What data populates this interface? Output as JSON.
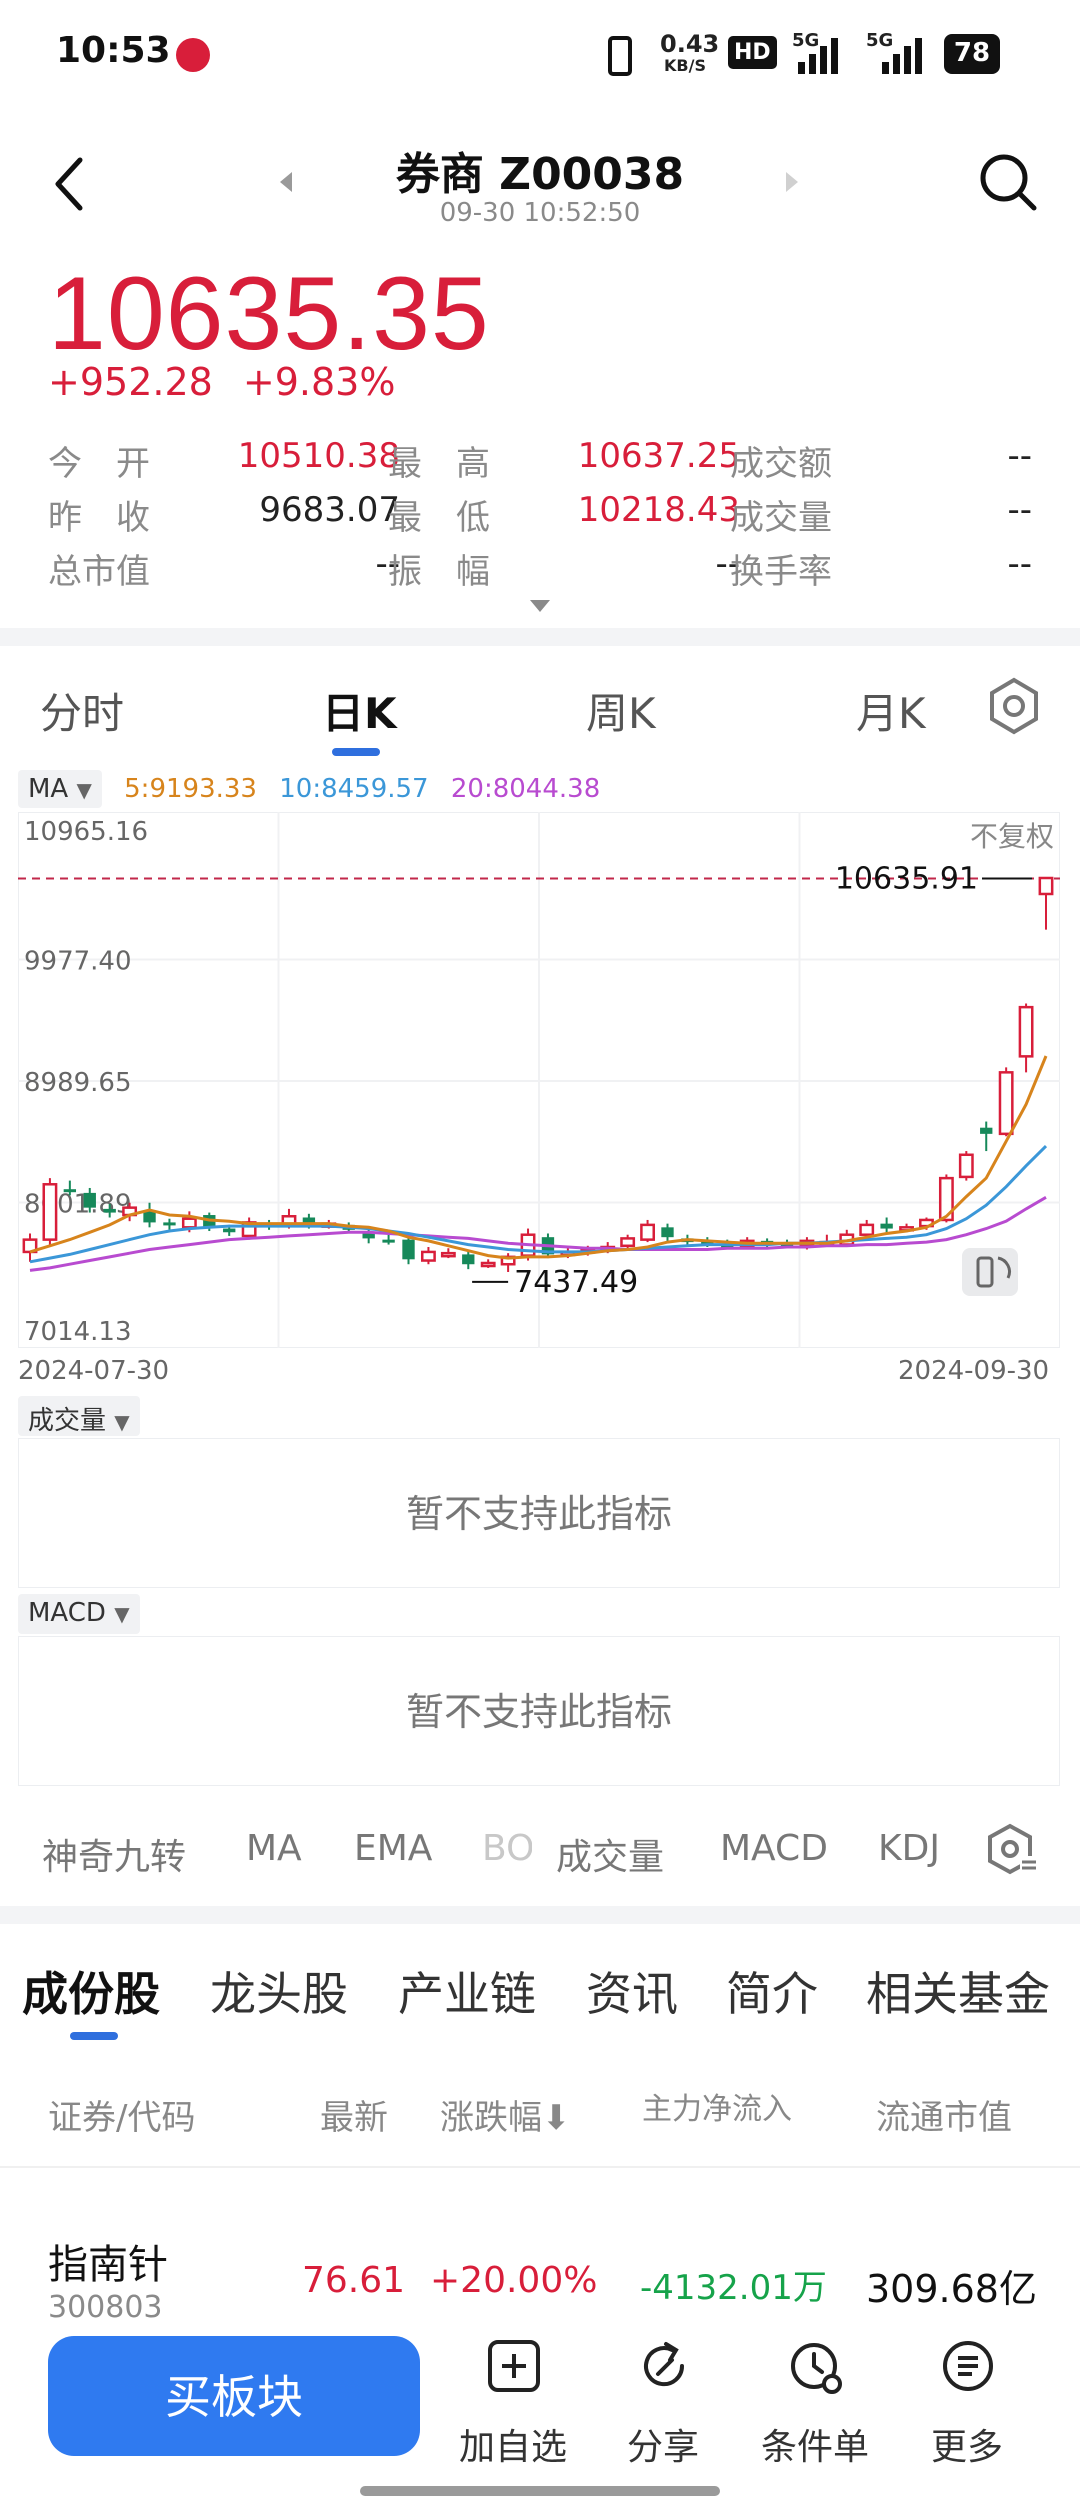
{
  "status_bar": {
    "time": "10:53",
    "net_speed_value": "0.43",
    "net_speed_unit": "KB/S",
    "hd_label": "HD",
    "sig1_label": "5G",
    "sig2_label": "5G",
    "battery": "78"
  },
  "header": {
    "title": "券商 Z00038",
    "datetime": "09-30 10:52:50"
  },
  "quote": {
    "price": "10635.35",
    "change": "+952.28",
    "change_pct": "+9.83%",
    "rows": [
      [
        {
          "label": "今　开",
          "value": "10510.38",
          "color": "red"
        },
        {
          "label": "最　高",
          "value": "10637.25",
          "color": "red"
        },
        {
          "label": "成交额",
          "value": "--",
          "color": "dark"
        }
      ],
      [
        {
          "label": "昨　收",
          "value": "9683.07",
          "color": "dark"
        },
        {
          "label": "最　低",
          "value": "10218.43",
          "color": "red"
        },
        {
          "label": "成交量",
          "value": "--",
          "color": "dark"
        }
      ],
      [
        {
          "label": "总市值",
          "value": "--",
          "color": "dark"
        },
        {
          "label": "振　幅",
          "value": "--",
          "color": "dark"
        },
        {
          "label": "换手率",
          "value": "--",
          "color": "dark"
        }
      ]
    ]
  },
  "kline_tabs": [
    {
      "label": "分时",
      "active": false
    },
    {
      "label": "日K",
      "active": true
    },
    {
      "label": "周K",
      "active": false
    },
    {
      "label": "月K",
      "active": false
    }
  ],
  "ma_legend": {
    "selector": "MA",
    "items": [
      {
        "text": "5:9193.33",
        "color": "#d7841c"
      },
      {
        "text": "10:8459.57",
        "color": "#3b97d8"
      },
      {
        "text": "20:8044.38",
        "color": "#b84bd0"
      }
    ]
  },
  "chart_data": {
    "type": "candlestick",
    "x_start": "2024-07-30",
    "x_end": "2024-09-30",
    "ylim": [
      7014.13,
      10965.16
    ],
    "y_ticks": [
      "10965.16",
      "9977.40",
      "8989.65",
      "8001.89",
      "7014.13"
    ],
    "adjust_label": "不复权",
    "last_price_label": "10635.91",
    "last_price": 10635.91,
    "low_label": "7437.49",
    "low_value": 7437.49,
    "up_color": "#d81e3a",
    "down_color": "#16895a",
    "candles": [
      {
        "o": 7600,
        "c": 7700,
        "h": 7750,
        "l": 7520
      },
      {
        "o": 7700,
        "c": 8150,
        "h": 8200,
        "l": 7650
      },
      {
        "o": 8110,
        "c": 8100,
        "h": 8180,
        "l": 8060
      },
      {
        "o": 8080,
        "c": 7960,
        "h": 8120,
        "l": 7920
      },
      {
        "o": 7950,
        "c": 7920,
        "h": 7990,
        "l": 7880
      },
      {
        "o": 7900,
        "c": 7960,
        "h": 8000,
        "l": 7850
      },
      {
        "o": 7940,
        "c": 7840,
        "h": 8000,
        "l": 7800
      },
      {
        "o": 7840,
        "c": 7820,
        "h": 7870,
        "l": 7780
      },
      {
        "o": 7800,
        "c": 7870,
        "h": 7930,
        "l": 7760
      },
      {
        "o": 7900,
        "c": 7800,
        "h": 7920,
        "l": 7770
      },
      {
        "o": 7790,
        "c": 7760,
        "h": 7820,
        "l": 7730
      },
      {
        "o": 7730,
        "c": 7840,
        "h": 7880,
        "l": 7700
      },
      {
        "o": 7830,
        "c": 7820,
        "h": 7860,
        "l": 7780
      },
      {
        "o": 7820,
        "c": 7890,
        "h": 7950,
        "l": 7790
      },
      {
        "o": 7880,
        "c": 7820,
        "h": 7910,
        "l": 7790
      },
      {
        "o": 7830,
        "c": 7830,
        "h": 7860,
        "l": 7790
      },
      {
        "o": 7820,
        "c": 7780,
        "h": 7840,
        "l": 7750
      },
      {
        "o": 7760,
        "c": 7710,
        "h": 7780,
        "l": 7670
      },
      {
        "o": 7700,
        "c": 7690,
        "h": 7740,
        "l": 7660
      },
      {
        "o": 7700,
        "c": 7540,
        "h": 7720,
        "l": 7500
      },
      {
        "o": 7530,
        "c": 7600,
        "h": 7640,
        "l": 7500
      },
      {
        "o": 7590,
        "c": 7590,
        "h": 7630,
        "l": 7550
      },
      {
        "o": 7580,
        "c": 7500,
        "h": 7600,
        "l": 7460
      },
      {
        "o": 7500,
        "c": 7510,
        "h": 7540,
        "l": 7470
      },
      {
        "o": 7500,
        "c": 7560,
        "h": 7590,
        "l": 7437
      },
      {
        "o": 7570,
        "c": 7740,
        "h": 7790,
        "l": 7530
      },
      {
        "o": 7720,
        "c": 7580,
        "h": 7750,
        "l": 7550
      },
      {
        "o": 7580,
        "c": 7600,
        "h": 7640,
        "l": 7550
      },
      {
        "o": 7600,
        "c": 7620,
        "h": 7650,
        "l": 7570
      },
      {
        "o": 7620,
        "c": 7640,
        "h": 7680,
        "l": 7590
      },
      {
        "o": 7650,
        "c": 7710,
        "h": 7740,
        "l": 7620
      },
      {
        "o": 7700,
        "c": 7820,
        "h": 7860,
        "l": 7680
      },
      {
        "o": 7800,
        "c": 7720,
        "h": 7830,
        "l": 7690
      },
      {
        "o": 7710,
        "c": 7680,
        "h": 7740,
        "l": 7650
      },
      {
        "o": 7690,
        "c": 7660,
        "h": 7720,
        "l": 7640
      },
      {
        "o": 7660,
        "c": 7650,
        "h": 7700,
        "l": 7620
      },
      {
        "o": 7650,
        "c": 7690,
        "h": 7720,
        "l": 7620
      },
      {
        "o": 7690,
        "c": 7670,
        "h": 7710,
        "l": 7640
      },
      {
        "o": 7670,
        "c": 7650,
        "h": 7700,
        "l": 7630
      },
      {
        "o": 7650,
        "c": 7690,
        "h": 7720,
        "l": 7620
      },
      {
        "o": 7680,
        "c": 7680,
        "h": 7740,
        "l": 7640
      },
      {
        "o": 7660,
        "c": 7740,
        "h": 7780,
        "l": 7640
      },
      {
        "o": 7740,
        "c": 7820,
        "h": 7860,
        "l": 7720
      },
      {
        "o": 7830,
        "c": 7790,
        "h": 7880,
        "l": 7760
      },
      {
        "o": 7790,
        "c": 7800,
        "h": 7830,
        "l": 7760
      },
      {
        "o": 7810,
        "c": 7860,
        "h": 7880,
        "l": 7780
      },
      {
        "o": 7860,
        "c": 8200,
        "h": 8230,
        "l": 7840
      },
      {
        "o": 8210,
        "c": 8390,
        "h": 8420,
        "l": 8180
      },
      {
        "o": 8610,
        "c": 8560,
        "h": 8660,
        "l": 8420
      },
      {
        "o": 8560,
        "c": 9060,
        "h": 9100,
        "l": 8540
      },
      {
        "o": 9190,
        "c": 9590,
        "h": 9620,
        "l": 9060
      },
      {
        "o": 10510,
        "c": 10640,
        "h": 10640,
        "l": 10220
      }
    ],
    "ma5": [
      7600,
      7650,
      7700,
      7760,
      7820,
      7900,
      7940,
      7900,
      7890,
      7860,
      7850,
      7830,
      7830,
      7830,
      7830,
      7830,
      7810,
      7800,
      7770,
      7720,
      7690,
      7650,
      7610,
      7570,
      7550,
      7560,
      7560,
      7570,
      7590,
      7610,
      7620,
      7640,
      7680,
      7700,
      7690,
      7680,
      7670,
      7670,
      7670,
      7670,
      7670,
      7690,
      7720,
      7750,
      7770,
      7800,
      7890,
      8050,
      8200,
      8500,
      8800,
      9193
    ],
    "ma10": [
      7520,
      7550,
      7580,
      7620,
      7660,
      7700,
      7740,
      7770,
      7790,
      7800,
      7810,
      7810,
      7810,
      7810,
      7810,
      7810,
      7800,
      7790,
      7770,
      7750,
      7720,
      7690,
      7660,
      7640,
      7620,
      7610,
      7600,
      7600,
      7600,
      7610,
      7620,
      7630,
      7640,
      7650,
      7660,
      7660,
      7660,
      7660,
      7670,
      7670,
      7680,
      7690,
      7700,
      7710,
      7720,
      7740,
      7790,
      7870,
      7980,
      8130,
      8300,
      8460
    ],
    "ma20": [
      7450,
      7470,
      7500,
      7530,
      7560,
      7590,
      7620,
      7640,
      7660,
      7680,
      7700,
      7710,
      7720,
      7730,
      7740,
      7750,
      7760,
      7760,
      7750,
      7740,
      7730,
      7720,
      7710,
      7690,
      7670,
      7660,
      7650,
      7640,
      7630,
      7630,
      7620,
      7620,
      7620,
      7620,
      7620,
      7630,
      7630,
      7630,
      7640,
      7640,
      7650,
      7650,
      7660,
      7660,
      7670,
      7680,
      7700,
      7740,
      7790,
      7850,
      7950,
      8044
    ]
  },
  "panels": {
    "volume_label": "成交量",
    "volume_msg": "暂不支持此指标",
    "macd_label": "MACD",
    "macd_msg": "暂不支持此指标"
  },
  "indicators": [
    {
      "label": "神奇九转",
      "active": false
    },
    {
      "label": "MA",
      "active": true
    },
    {
      "label": "EMA",
      "active": false
    },
    {
      "label": "BO",
      "active": false
    },
    {
      "label": "成交量",
      "active": true
    },
    {
      "label": "MACD",
      "active": true
    },
    {
      "label": "KDJ",
      "active": false
    }
  ],
  "section_tabs": [
    {
      "label": "成份股",
      "active": true
    },
    {
      "label": "龙头股",
      "active": false
    },
    {
      "label": "产业链",
      "active": false
    },
    {
      "label": "资讯",
      "active": false
    },
    {
      "label": "简介",
      "active": false
    },
    {
      "label": "相关基金",
      "active": false
    }
  ],
  "table": {
    "headers": [
      "证券/代码",
      "最新",
      "涨跌幅⬇",
      "主力净流入",
      "流通市值"
    ],
    "rows": [
      {
        "name": "指南针",
        "code": "300803",
        "last": "76.61",
        "pct": "+20.00%",
        "inflow": "-4132.01万",
        "cap": "309.68亿"
      }
    ]
  },
  "bottom_bar": {
    "buy_label": "买板块",
    "items": [
      {
        "label": "加自选",
        "icon": "add-watchlist-icon"
      },
      {
        "label": "分享",
        "icon": "share-icon"
      },
      {
        "label": "条件单",
        "icon": "condition-order-icon"
      },
      {
        "label": "更多",
        "icon": "more-icon"
      }
    ]
  }
}
